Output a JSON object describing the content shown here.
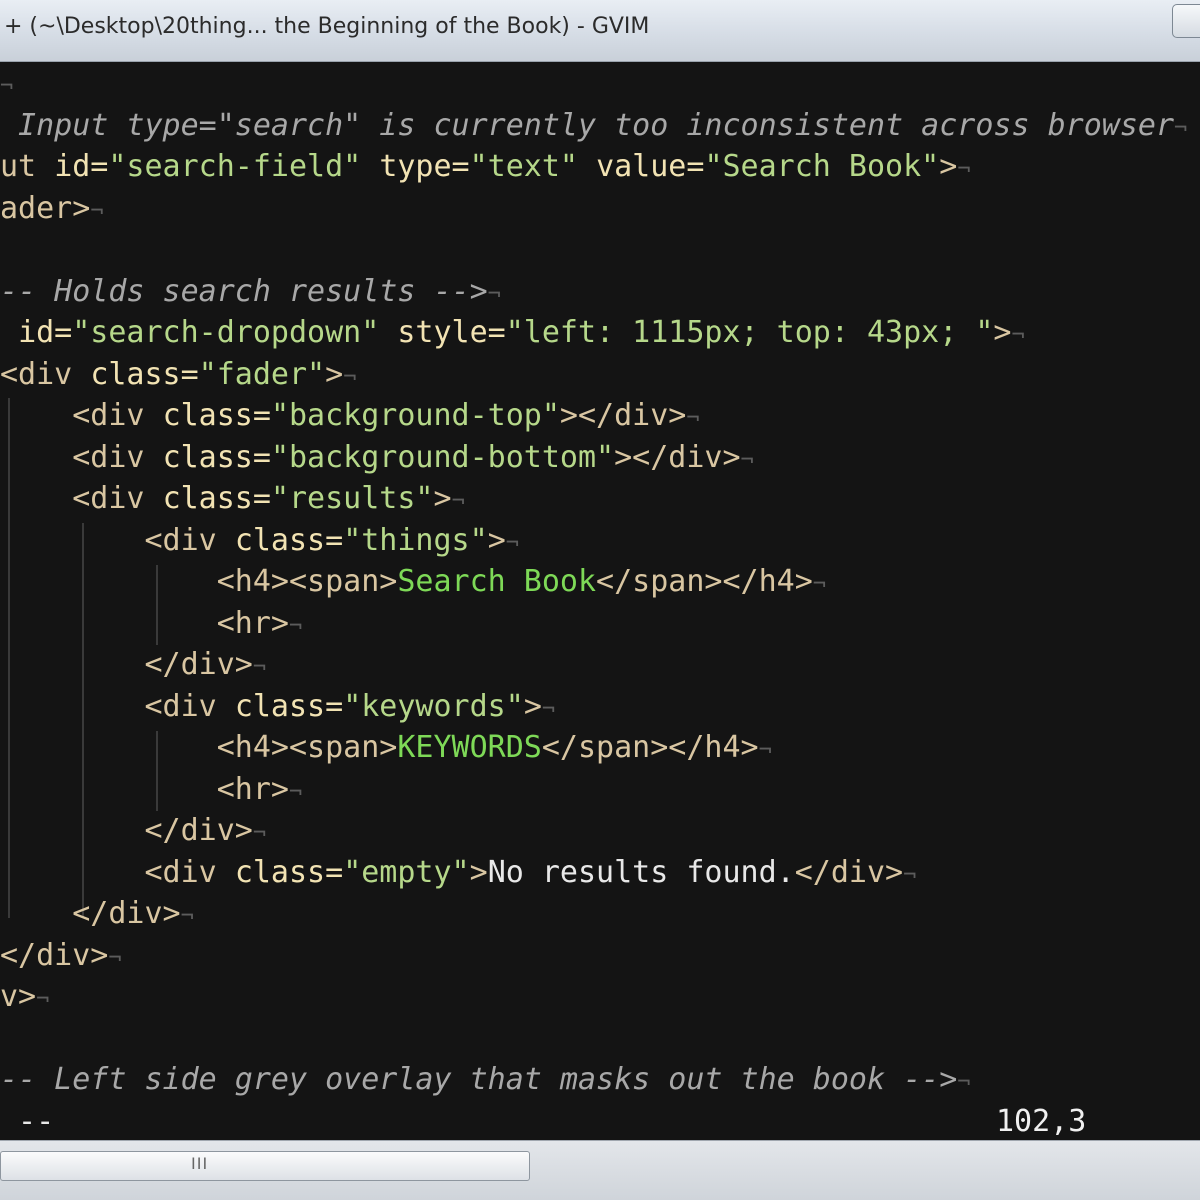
{
  "window": {
    "title": "+ (~\\Desktop\\20thing... the Beginning of the Book) - GVIM"
  },
  "colors": {
    "background": "#141414",
    "comment": "#a8a8a8",
    "tag": "#d9c6a2",
    "attribute": "#f2e3b3",
    "string": "#b6d88a",
    "highlight": "#7ed957"
  },
  "editor": {
    "eol_char": "¬",
    "lines": [
      {
        "tokens": []
      },
      {
        "tokens": [
          [
            "comment",
            " Input type=\"search\" is currently too inconsistent across browser"
          ]
        ]
      },
      {
        "tokens": [
          [
            "tag",
            "ut "
          ],
          [
            "attr",
            "id="
          ],
          [
            "str",
            "\"search-field\""
          ],
          [
            "tag",
            " "
          ],
          [
            "attr",
            "type="
          ],
          [
            "str",
            "\"text\""
          ],
          [
            "tag",
            " "
          ],
          [
            "attr",
            "value="
          ],
          [
            "str",
            "\"Search Book\""
          ],
          [
            "tag",
            ">"
          ]
        ]
      },
      {
        "tokens": [
          [
            "tag",
            "ader>"
          ]
        ]
      },
      {
        "tokens": []
      },
      {
        "tokens": [
          [
            "comment",
            "-- Holds search results -->"
          ]
        ]
      },
      {
        "tokens": [
          [
            "tag",
            " "
          ],
          [
            "attr",
            "id="
          ],
          [
            "str",
            "\"search-dropdown\""
          ],
          [
            "tag",
            " "
          ],
          [
            "attr",
            "style="
          ],
          [
            "str",
            "\"left: 1115px; top: 43px; \""
          ],
          [
            "tag",
            ">"
          ]
        ]
      },
      {
        "tokens": [
          [
            "tag",
            "<div "
          ],
          [
            "attr",
            "class="
          ],
          [
            "str",
            "\"fader\""
          ],
          [
            "tag",
            ">"
          ]
        ]
      },
      {
        "tokens": [
          [
            "tag",
            "    <div "
          ],
          [
            "attr",
            "class="
          ],
          [
            "str",
            "\"background-top\""
          ],
          [
            "tag",
            "></div>"
          ]
        ]
      },
      {
        "tokens": [
          [
            "tag",
            "    <div "
          ],
          [
            "attr",
            "class="
          ],
          [
            "str",
            "\"background-bottom\""
          ],
          [
            "tag",
            "></div>"
          ]
        ]
      },
      {
        "tokens": [
          [
            "tag",
            "    <div "
          ],
          [
            "attr",
            "class="
          ],
          [
            "str",
            "\"results\""
          ],
          [
            "tag",
            ">"
          ]
        ]
      },
      {
        "tokens": [
          [
            "tag",
            "        <div "
          ],
          [
            "attr",
            "class="
          ],
          [
            "str",
            "\"things\""
          ],
          [
            "tag",
            ">"
          ]
        ]
      },
      {
        "tokens": [
          [
            "tag",
            "            <h4><span>"
          ],
          [
            "hl",
            "Search Book"
          ],
          [
            "tag",
            "</span></h4>"
          ]
        ]
      },
      {
        "tokens": [
          [
            "tag",
            "            <hr>"
          ]
        ]
      },
      {
        "tokens": [
          [
            "tag",
            "        </div>"
          ]
        ]
      },
      {
        "tokens": [
          [
            "tag",
            "        <div "
          ],
          [
            "attr",
            "class="
          ],
          [
            "str",
            "\"keywords\""
          ],
          [
            "tag",
            ">"
          ]
        ]
      },
      {
        "tokens": [
          [
            "tag",
            "            <h4><span>"
          ],
          [
            "hl",
            "KEYWORDS"
          ],
          [
            "tag",
            "</span></h4>"
          ]
        ]
      },
      {
        "tokens": [
          [
            "tag",
            "            <hr>"
          ]
        ]
      },
      {
        "tokens": [
          [
            "tag",
            "        </div>"
          ]
        ]
      },
      {
        "tokens": [
          [
            "tag",
            "        <div "
          ],
          [
            "attr",
            "class="
          ],
          [
            "str",
            "\"empty\""
          ],
          [
            "tag",
            ">"
          ],
          [
            "text",
            "No results found."
          ],
          [
            "tag",
            "</div>"
          ]
        ]
      },
      {
        "tokens": [
          [
            "tag",
            "    </div>"
          ]
        ]
      },
      {
        "tokens": [
          [
            "tag",
            "</div>"
          ]
        ]
      },
      {
        "tokens": [
          [
            "tag",
            "v>"
          ]
        ]
      },
      {
        "tokens": []
      },
      {
        "tokens": [
          [
            "comment",
            "-- Left side grey overlay that masks out the book -->"
          ]
        ]
      }
    ]
  },
  "statusline": {
    "mode": " --",
    "position": "102,3"
  },
  "scrollbar": {
    "grip": "III"
  }
}
